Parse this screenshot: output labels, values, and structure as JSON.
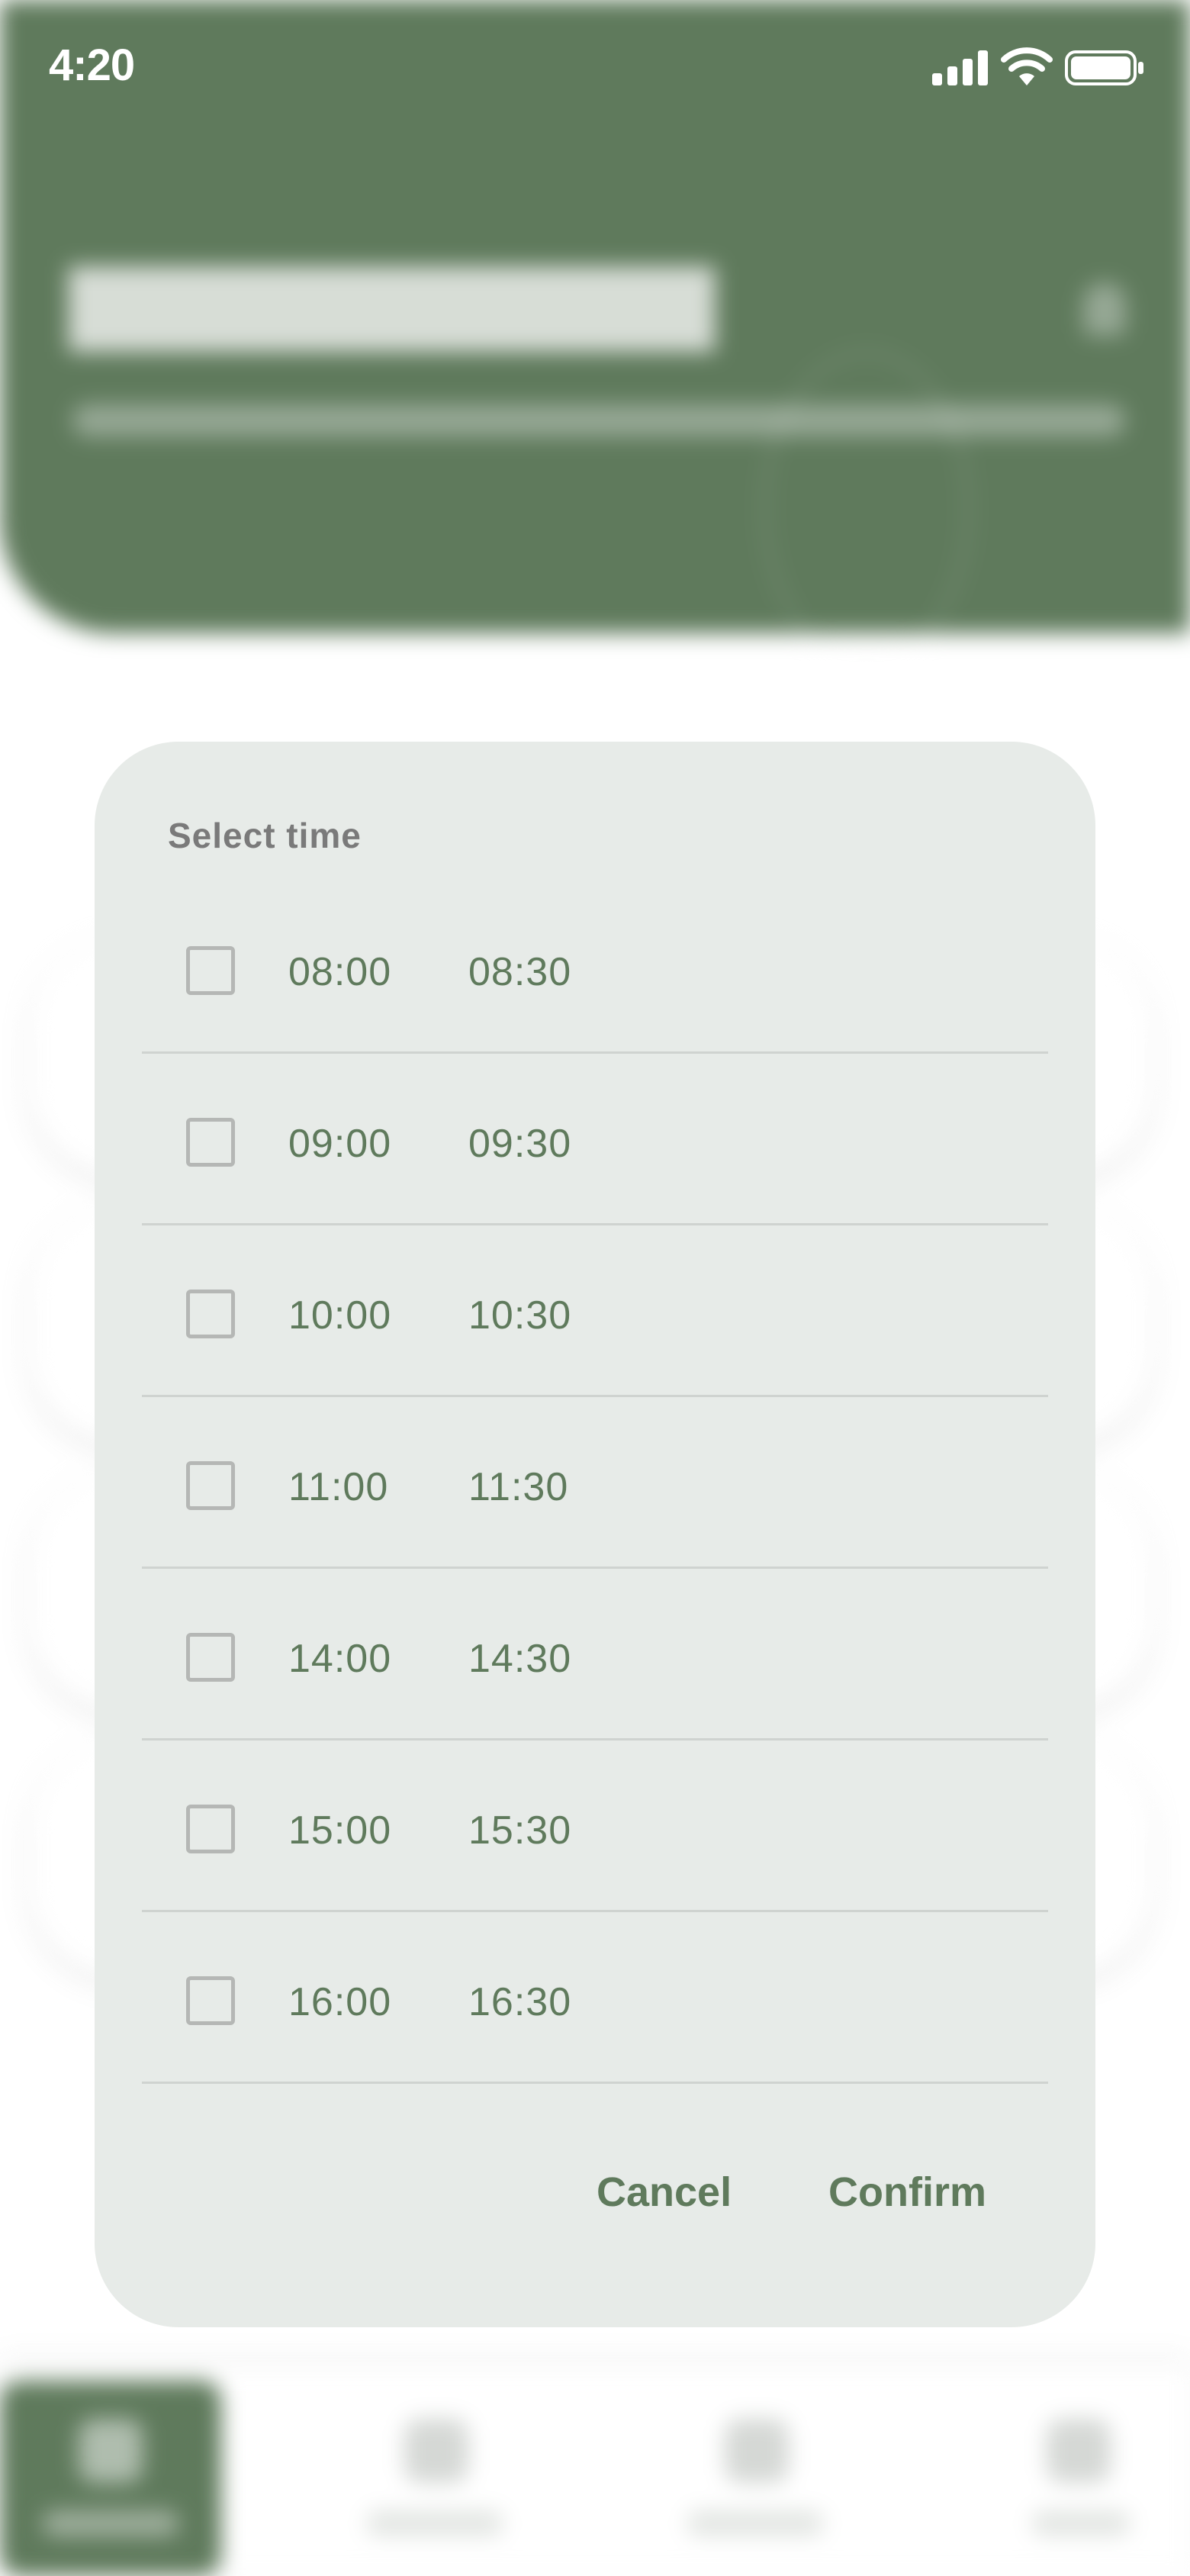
{
  "status_bar": {
    "time": "4:20",
    "icons": [
      "signal-icon",
      "wifi-icon",
      "battery-icon"
    ]
  },
  "dialog": {
    "title": "Select time",
    "slots": [
      {
        "start": "08:00",
        "end": "08:30",
        "checked": false
      },
      {
        "start": "09:00",
        "end": "09:30",
        "checked": false
      },
      {
        "start": "10:00",
        "end": "10:30",
        "checked": false
      },
      {
        "start": "11:00",
        "end": "11:30",
        "checked": false
      },
      {
        "start": "14:00",
        "end": "14:30",
        "checked": false
      },
      {
        "start": "15:00",
        "end": "15:30",
        "checked": false
      },
      {
        "start": "16:00",
        "end": "16:30",
        "checked": false
      }
    ],
    "cancel_label": "Cancel",
    "confirm_label": "Confirm"
  },
  "colors": {
    "brand_green": "#5f7a5c",
    "dialog_background": "#e7ebe8",
    "divider": "#cfd3d0",
    "checkbox_border": "#b5b7b5",
    "title_gray": "#7a7a7a"
  }
}
